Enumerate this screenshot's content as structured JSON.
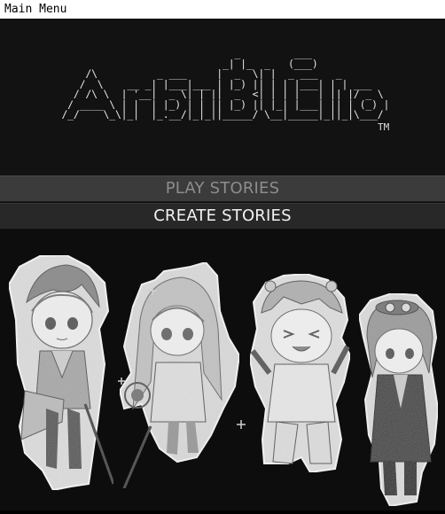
{
  "window": {
    "title": "Main Menu"
  },
  "logo": {
    "ascii_lines": [
      "                               _         ___",
      "                             _| |_  _   (___)",
      "      /\\          _ ___     |  _  \\| |  _ ___   _",
      "     /  \\    __ _| |___|___ | |_) || | | |___| | | ___",
      "    / /\\ \\  | '__|  _ \\| | ||  _  <| | | |   | || |/ _ \\",
      "   / ____ \\ | |  | |_) | | || |_) || |_| |___| || | (_) |",
      "  /_/    \\_\\|_|  |_.__/|_|_||_____/ \\__|_____|_||_|\\___/"
    ],
    "trademark": "TM"
  },
  "menu": {
    "play_label": "PLAY STORIES",
    "create_label": "CREATE STORIES"
  },
  "colors": {
    "background": "#0d0d0d",
    "logo_band": "#121212",
    "play_button_bg": "#3b3b3b",
    "play_button_text": "#8d8d8d",
    "create_button_bg": "#282828",
    "create_button_text": "#f2f2f2"
  },
  "artwork": {
    "subject": "pencil-sketch chibi characters",
    "icons": [
      "character-sketch-1",
      "character-sketch-2",
      "character-sketch-3",
      "character-sketch-4"
    ]
  }
}
